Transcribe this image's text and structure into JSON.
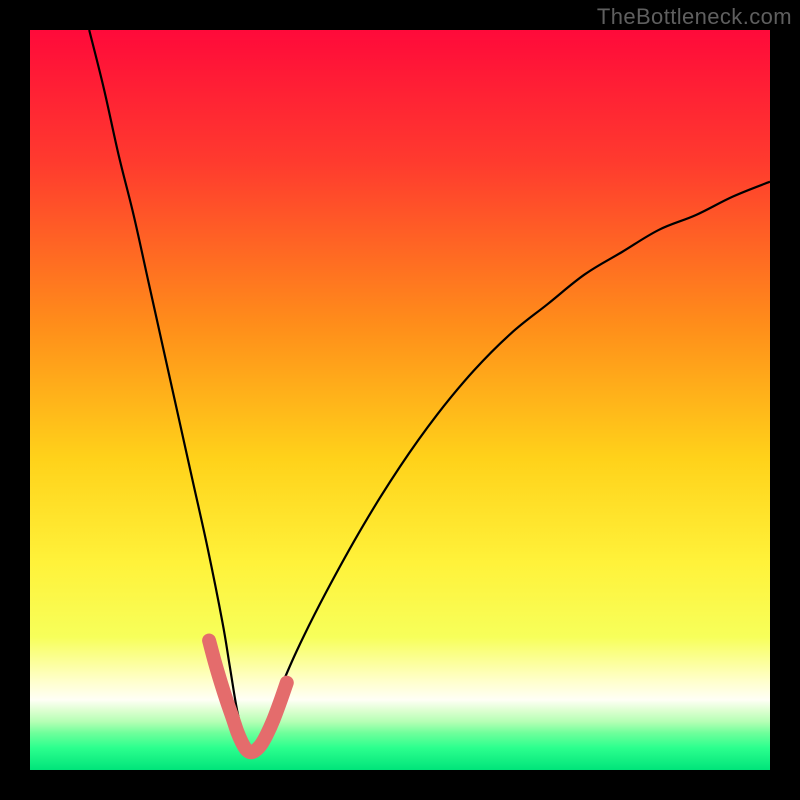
{
  "watermark": "TheBottleneck.com",
  "chart_data": {
    "type": "line",
    "title": "",
    "xlabel": "",
    "ylabel": "",
    "xlim": [
      0,
      100
    ],
    "ylim": [
      0,
      100
    ],
    "legend": false,
    "grid": false,
    "background_gradient_stops": [
      {
        "offset": 0.0,
        "color": "#ff0a3a"
      },
      {
        "offset": 0.18,
        "color": "#ff3b2e"
      },
      {
        "offset": 0.4,
        "color": "#ff8e1a"
      },
      {
        "offset": 0.58,
        "color": "#ffd21a"
      },
      {
        "offset": 0.72,
        "color": "#fff23a"
      },
      {
        "offset": 0.82,
        "color": "#f7ff5a"
      },
      {
        "offset": 0.88,
        "color": "#ffffcc"
      },
      {
        "offset": 0.905,
        "color": "#fffff6"
      },
      {
        "offset": 0.92,
        "color": "#dcffd0"
      },
      {
        "offset": 0.935,
        "color": "#b4ffb4"
      },
      {
        "offset": 0.95,
        "color": "#6fff9b"
      },
      {
        "offset": 0.97,
        "color": "#2cff8e"
      },
      {
        "offset": 1.0,
        "color": "#00e47a"
      }
    ],
    "curve": {
      "x": [
        8,
        10,
        12,
        14,
        16,
        18,
        20,
        22,
        24,
        26,
        27,
        28,
        29,
        30,
        31,
        33,
        36,
        40,
        45,
        50,
        55,
        60,
        65,
        70,
        75,
        80,
        85,
        90,
        95,
        100
      ],
      "y": [
        100,
        92,
        83,
        75,
        66,
        57,
        48,
        39,
        30,
        20,
        14,
        8,
        4,
        2,
        4,
        9,
        16,
        24,
        33,
        41,
        48,
        54,
        59,
        63,
        67,
        70,
        73,
        75,
        77.5,
        79.5
      ]
    },
    "highlight_segment": {
      "color": "#e46c6c",
      "width": 14,
      "x": [
        24.2,
        25.0,
        25.8,
        26.6,
        27.4,
        28.0,
        28.6,
        29.2,
        29.8,
        30.4,
        31.2,
        32.0,
        32.9,
        33.8,
        34.7
      ],
      "y": [
        17.5,
        14.5,
        11.8,
        9.3,
        7.0,
        5.2,
        3.8,
        2.8,
        2.4,
        2.6,
        3.4,
        4.8,
        6.8,
        9.2,
        11.8
      ]
    }
  }
}
